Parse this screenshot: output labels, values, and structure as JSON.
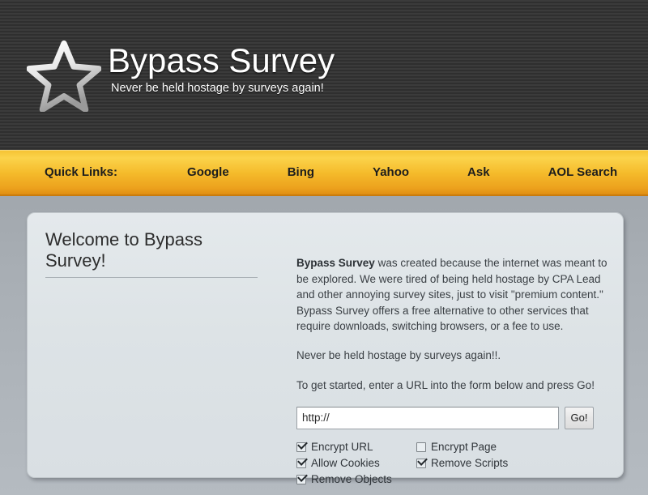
{
  "header": {
    "logo_icon": "star-outline-icon",
    "title": "Bypass Survey",
    "tagline": "Never be held hostage by surveys again!"
  },
  "nav": {
    "label": "Quick Links:",
    "links": [
      {
        "label": "Google"
      },
      {
        "label": "Bing"
      },
      {
        "label": "Yahoo"
      },
      {
        "label": "Ask"
      },
      {
        "label": "AOL Search"
      }
    ]
  },
  "main": {
    "heading": "Welcome to Bypass Survey!",
    "intro_bold": "Bypass Survey",
    "intro_rest": " was created because the internet was meant to be explored. We were tired of being held hostage by CPA Lead and other annoying survey sites, just to visit \"premium content.\" Bypass Survey offers a free alternative to other services that require downloads, switching browsers, or a fee to use.",
    "tagline_paragraph": "Never be held hostage by surveys again!!.",
    "instructions": "To get started, enter a URL into the form below and press Go!",
    "form": {
      "url_value": "http://",
      "url_placeholder": "http://",
      "go_label": "Go!"
    },
    "options": [
      {
        "label": "Encrypt URL",
        "checked": true
      },
      {
        "label": "Encrypt Page",
        "checked": false
      },
      {
        "label": "Allow Cookies",
        "checked": true
      },
      {
        "label": "Remove Scripts",
        "checked": true
      },
      {
        "label": "Remove Objects",
        "checked": true
      }
    ]
  },
  "colors": {
    "header_bg": "#343434",
    "nav_gold_top": "#fbd34b",
    "nav_gold_bottom": "#e08e12",
    "panel_bg": "#dde3e6",
    "page_bg_top": "#888e95",
    "page_bg_bottom": "#b5bbc1",
    "text": "#3b4045"
  }
}
